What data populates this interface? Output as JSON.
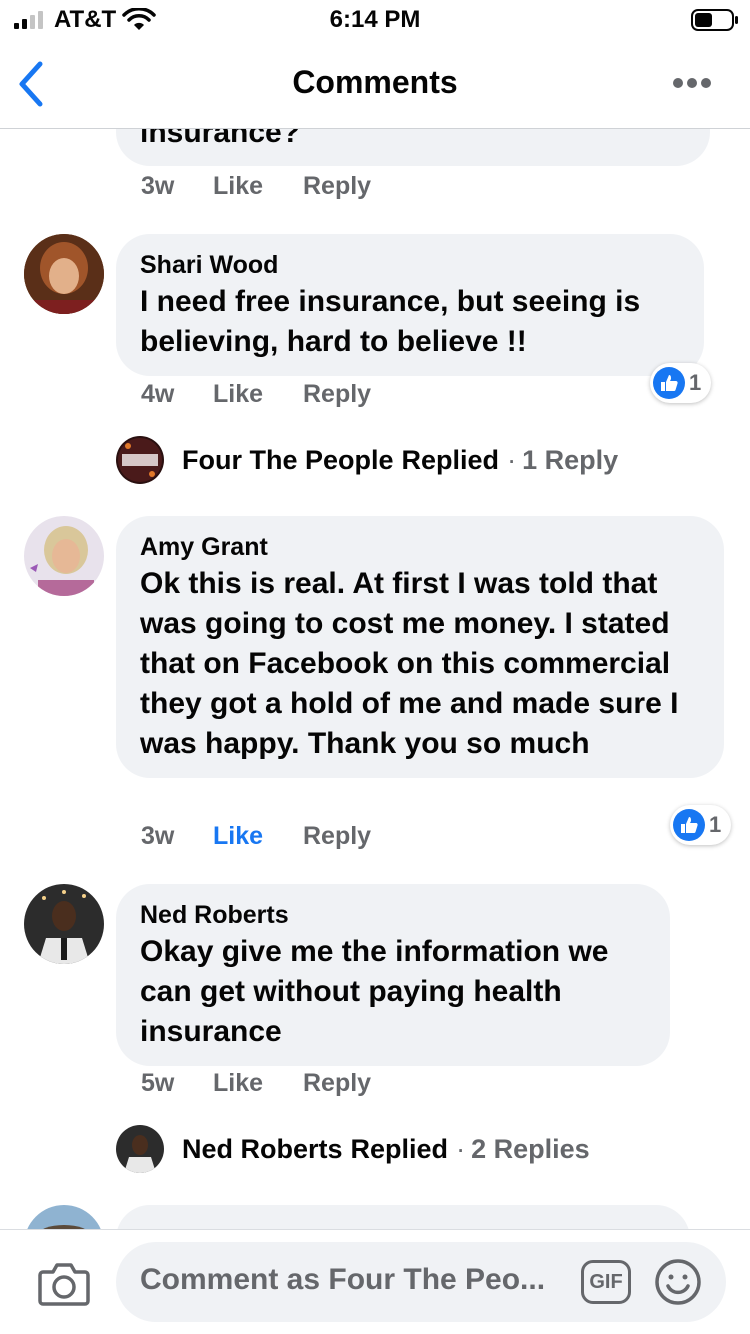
{
  "status_bar": {
    "carrier": "AT&T",
    "time": "6:14 PM"
  },
  "nav": {
    "title": "Comments"
  },
  "colors": {
    "accent": "#1877f2",
    "bubble": "#f0f2f5",
    "muted": "#65676b"
  },
  "comments": [
    {
      "text": "insurance?",
      "age": "3w",
      "like": "Like",
      "reply": "Reply"
    },
    {
      "name": "Shari Wood",
      "text": "I need free insurance, but seeing is believing, hard to believe !!",
      "age": "4w",
      "like": "Like",
      "reply": "Reply",
      "reactions": "1",
      "replied": {
        "name": "Four The People",
        "word": "Replied",
        "count": "1 Reply"
      }
    },
    {
      "name": "Amy Grant",
      "text": "Ok this is real. At first I was told that was going to cost me money. I stated that on Facebook on this commercial they got a hold of me and made sure I was happy. Thank you so much",
      "age": "3w",
      "like": "Like",
      "reply": "Reply",
      "reactions": "1",
      "liked": true
    },
    {
      "name": "Ned Roberts",
      "text": "Okay give me the information we can get without paying health insurance",
      "age": "5w",
      "like": "Like",
      "reply": "Reply",
      "replied": {
        "name": "Ned Roberts",
        "word": "Replied",
        "count": "2 Replies"
      }
    }
  ],
  "composer": {
    "placeholder": "Comment as Four The Peo...",
    "gif_label": "GIF"
  }
}
